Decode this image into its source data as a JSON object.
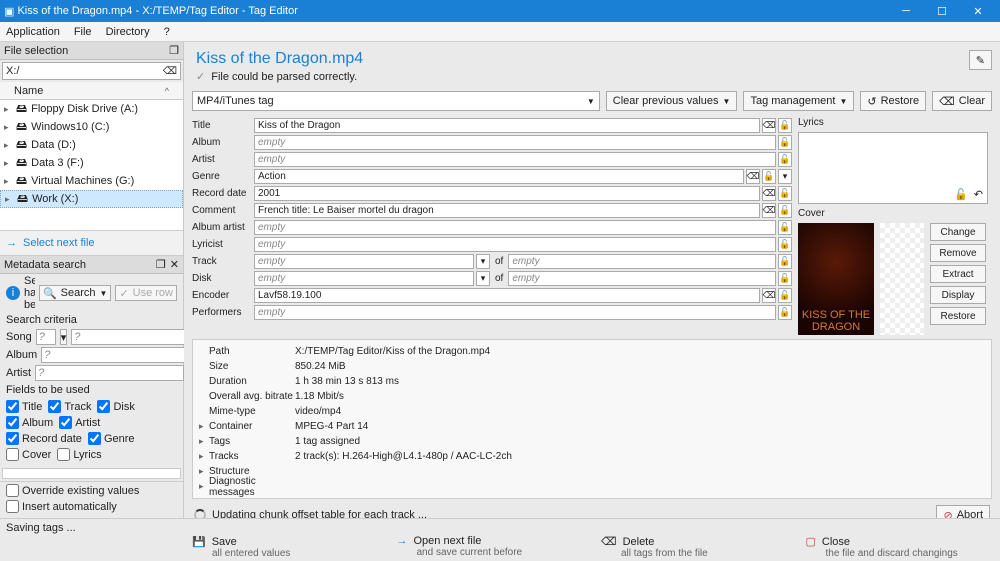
{
  "window": {
    "title": "Kiss of the Dragon.mp4 - X:/TEMP/Tag Editor - Tag Editor"
  },
  "menu": [
    "Application",
    "File",
    "Directory",
    "?"
  ],
  "left": {
    "fileSelection": "File selection",
    "path": "X:/",
    "nameHeader": "Name",
    "tree": [
      {
        "label": "Floppy Disk Drive (A:)",
        "sel": false
      },
      {
        "label": "Windows10 (C:)",
        "sel": false
      },
      {
        "label": "Data (D:)",
        "sel": false
      },
      {
        "label": "Data 3 (F:)",
        "sel": false
      },
      {
        "label": "Virtual Machines (G:)",
        "sel": false
      },
      {
        "label": "Work (X:)",
        "sel": true
      }
    ],
    "selectNext": "Select next file",
    "meta": {
      "header": "Metadata search",
      "status": "Search hasn't been",
      "searchBtn": "Search",
      "useRow": "Use row",
      "criteria": "Search criteria",
      "songLabel": "Song",
      "songVal": "?",
      "albumLabel": "Album",
      "albumVal": "?",
      "artistLabel": "Artist",
      "artistVal": "?",
      "fieldsHeader": "Fields to be used",
      "checks": [
        "Title",
        "Track",
        "Disk",
        "Album",
        "Artist",
        "Record date",
        "Genre",
        "Cover",
        "Lyrics"
      ],
      "overrideLabel": "Override existing values",
      "insertLabel": "Insert automatically"
    }
  },
  "main": {
    "title": "Kiss of the Dragon.mp4",
    "parseMsg": "File could be parsed correctly.",
    "tagType": "MP4/iTunes tag",
    "toolbar": {
      "clearPrev": "Clear previous values",
      "tagMgmt": "Tag management",
      "restore": "Restore",
      "clear": "Clear"
    },
    "fields": [
      {
        "label": "Title",
        "value": "Kiss of the Dragon",
        "ph": false,
        "x": true,
        "lock": true,
        "dd": false
      },
      {
        "label": "Album",
        "value": "empty",
        "ph": true,
        "x": false,
        "lock": true,
        "dd": false
      },
      {
        "label": "Artist",
        "value": "empty",
        "ph": true,
        "x": false,
        "lock": true,
        "dd": false
      },
      {
        "label": "Genre",
        "value": "Action",
        "ph": false,
        "x": true,
        "lock": true,
        "dd": true
      },
      {
        "label": "Record date",
        "value": "2001",
        "ph": false,
        "x": true,
        "lock": true,
        "dd": false
      },
      {
        "label": "Comment",
        "value": "French title: Le Baiser mortel du dragon",
        "ph": false,
        "x": true,
        "lock": true,
        "dd": false
      },
      {
        "label": "Album artist",
        "value": "empty",
        "ph": true,
        "x": false,
        "lock": true,
        "dd": false
      },
      {
        "label": "Lyricist",
        "value": "empty",
        "ph": true,
        "x": false,
        "lock": true,
        "dd": false
      },
      {
        "label": "Track",
        "value": "empty",
        "ph": true,
        "type": "pair",
        "of": "of",
        "value2": "empty",
        "lock": true
      },
      {
        "label": "Disk",
        "value": "empty",
        "ph": true,
        "type": "pair",
        "of": "of",
        "value2": "empty",
        "lock": true
      },
      {
        "label": "Encoder",
        "value": "Lavf58.19.100",
        "ph": false,
        "x": true,
        "lock": true,
        "dd": false
      },
      {
        "label": "Performers",
        "value": "empty",
        "ph": true,
        "x": false,
        "lock": true,
        "dd": false
      }
    ],
    "lyricsLabel": "Lyrics",
    "coverLabel": "Cover",
    "coverCaption": "KISS OF THE DRAGON",
    "coverBtns": [
      "Change",
      "Remove",
      "Extract",
      "Display",
      "Restore"
    ],
    "info": [
      {
        "k": "Path",
        "v": "X:/TEMP/Tag Editor/Kiss of the Dragon.mp4"
      },
      {
        "k": "Size",
        "v": "850.24 MiB"
      },
      {
        "k": "Duration",
        "v": "1 h 38 min 13 s 813 ms"
      },
      {
        "k": "Overall avg. bitrate",
        "v": "1.18 Mbit/s"
      },
      {
        "k": "Mime-type",
        "v": "video/mp4"
      },
      {
        "k": "Container",
        "v": "MPEG-4 Part 14",
        "arrow": true
      },
      {
        "k": "Tags",
        "v": "1 tag assigned",
        "arrow": true
      },
      {
        "k": "Tracks",
        "v": "2 track(s): H.264-High@L4.1-480p / AAC-LC-2ch",
        "arrow": true
      },
      {
        "k": "Structure",
        "v": "",
        "arrow": true
      },
      {
        "k": "Diagnostic messages",
        "v": "",
        "arrow": true
      }
    ],
    "progress": "Updating chunk offset table for each track ...",
    "abort": "Abort",
    "actions": [
      {
        "icon": "save",
        "title": "Save",
        "sub": "all entered values",
        "cls": "h"
      },
      {
        "icon": "next",
        "title": "Open next file",
        "sub": "and save current before",
        "cls": "h"
      },
      {
        "icon": "del",
        "title": "Delete",
        "sub": "all tags from the file",
        "cls": "h del"
      },
      {
        "icon": "close",
        "title": "Close",
        "sub": "the file and discard changings",
        "cls": "h cls"
      }
    ]
  },
  "status": "Saving tags ..."
}
